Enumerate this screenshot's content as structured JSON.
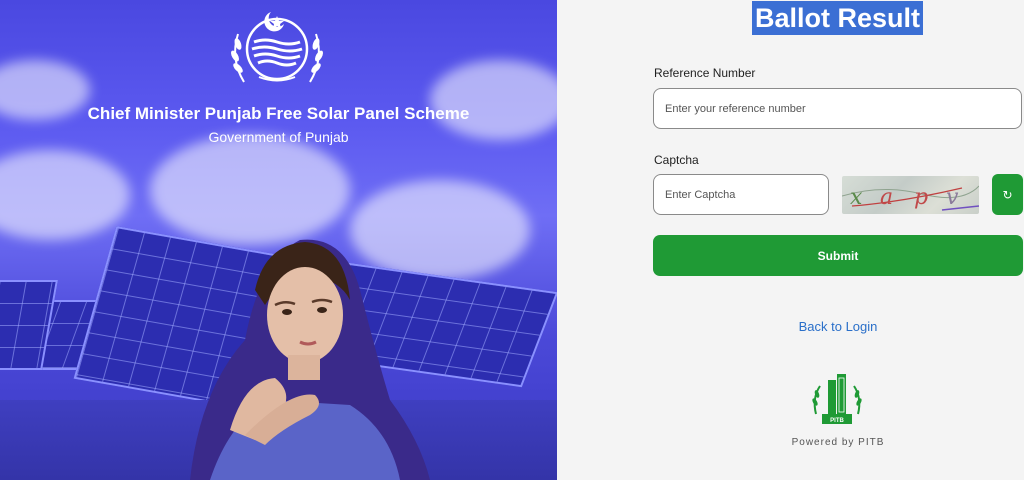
{
  "left_panel": {
    "title": "Chief Minister Punjab Free Solar Panel Scheme",
    "subtitle": "Government of Punjab",
    "emblem_icon": "punjab-government-emblem",
    "hero_image": "chief-minister-portrait-with-solar-panels"
  },
  "form": {
    "heading": "Ballot Result",
    "reference_label": "Reference Number",
    "reference_placeholder": "Enter your reference number",
    "reference_value": "",
    "captcha_label": "Captcha",
    "captcha_placeholder": "Enter Captcha",
    "captcha_value": "",
    "captcha_image_text": "x a p v",
    "refresh_glyph": "↻",
    "submit_label": "Submit",
    "back_link": "Back to Login",
    "powered_by": "Powered by PITB"
  },
  "colors": {
    "accent_green": "#1f9a35",
    "heading_highlight": "#3b6fd4",
    "link_blue": "#2a6fc9",
    "left_bg": "#4a48e0"
  }
}
